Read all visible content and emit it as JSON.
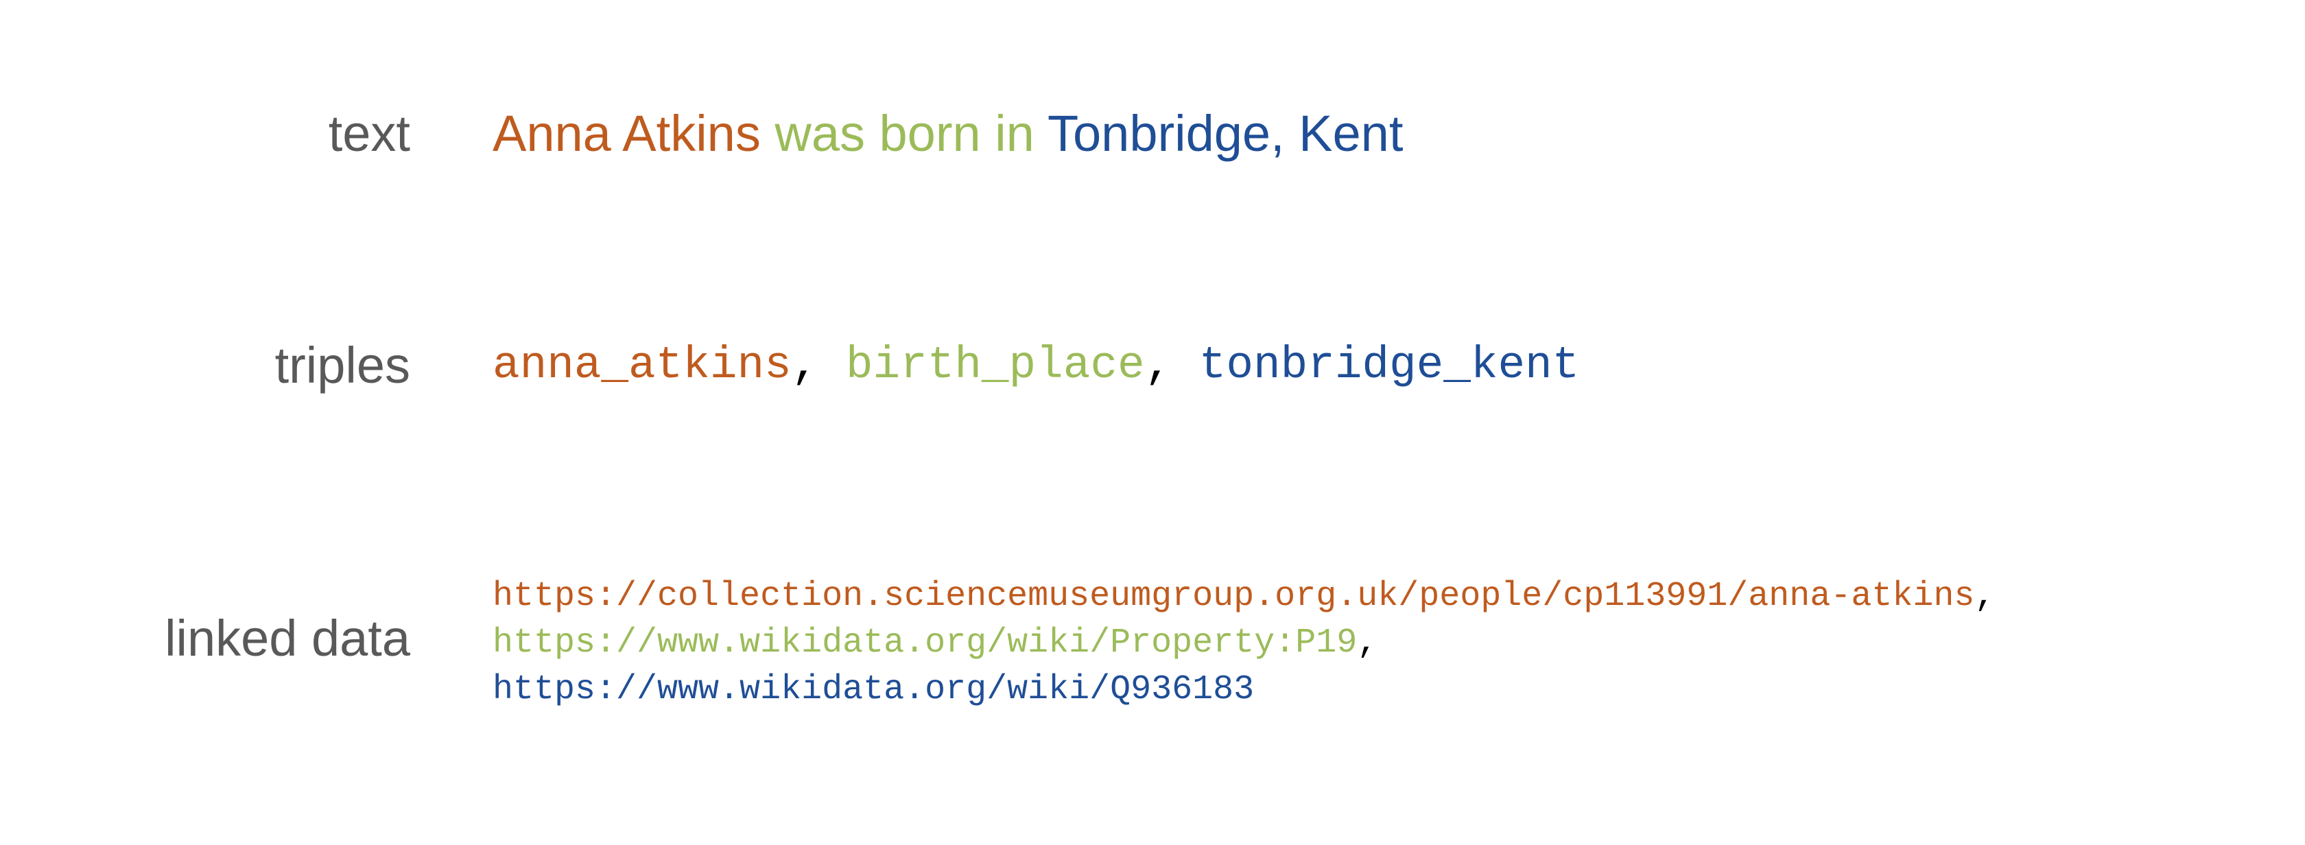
{
  "colors": {
    "subject": "#bf5b1f",
    "predicate": "#9bbb59",
    "object": "#1f4e96",
    "label": "#595959",
    "separator": "#000000"
  },
  "rows": {
    "text": {
      "label": "text",
      "subject": "Anna Atkins",
      "predicate": "was born in",
      "object": "Tonbridge, Kent"
    },
    "triples": {
      "label": "triples",
      "subject": "anna_atkins",
      "predicate": "birth_place",
      "object": "tonbridge_kent",
      "separator": ","
    },
    "linked_data": {
      "label": "linked data",
      "subject": "https://collection.sciencemuseumgroup.org.uk/people/cp113991/anna-atkins",
      "predicate": "https://www.wikidata.org/wiki/Property:P19",
      "object": "https://www.wikidata.org/wiki/Q936183",
      "separator": ","
    }
  }
}
